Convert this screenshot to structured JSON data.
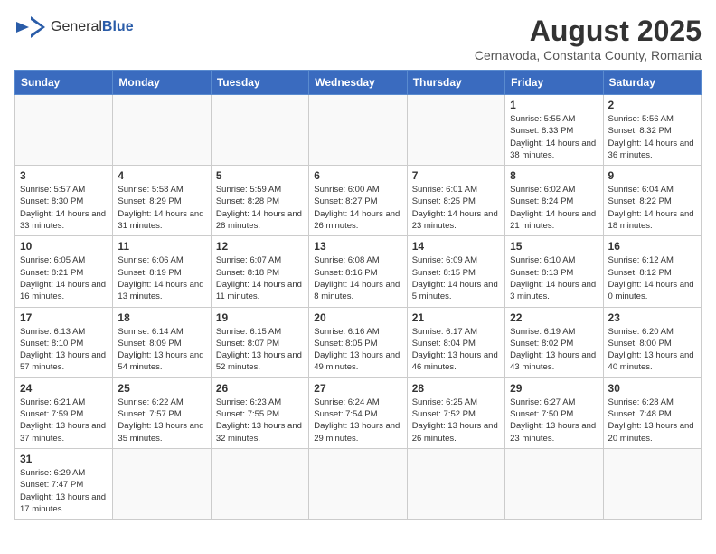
{
  "header": {
    "logo_general": "General",
    "logo_blue": "Blue",
    "month_year": "August 2025",
    "location": "Cernavoda, Constanta County, Romania"
  },
  "days_of_week": [
    "Sunday",
    "Monday",
    "Tuesday",
    "Wednesday",
    "Thursday",
    "Friday",
    "Saturday"
  ],
  "weeks": [
    [
      {
        "day": "",
        "info": ""
      },
      {
        "day": "",
        "info": ""
      },
      {
        "day": "",
        "info": ""
      },
      {
        "day": "",
        "info": ""
      },
      {
        "day": "",
        "info": ""
      },
      {
        "day": "1",
        "info": "Sunrise: 5:55 AM\nSunset: 8:33 PM\nDaylight: 14 hours and 38 minutes."
      },
      {
        "day": "2",
        "info": "Sunrise: 5:56 AM\nSunset: 8:32 PM\nDaylight: 14 hours and 36 minutes."
      }
    ],
    [
      {
        "day": "3",
        "info": "Sunrise: 5:57 AM\nSunset: 8:30 PM\nDaylight: 14 hours and 33 minutes."
      },
      {
        "day": "4",
        "info": "Sunrise: 5:58 AM\nSunset: 8:29 PM\nDaylight: 14 hours and 31 minutes."
      },
      {
        "day": "5",
        "info": "Sunrise: 5:59 AM\nSunset: 8:28 PM\nDaylight: 14 hours and 28 minutes."
      },
      {
        "day": "6",
        "info": "Sunrise: 6:00 AM\nSunset: 8:27 PM\nDaylight: 14 hours and 26 minutes."
      },
      {
        "day": "7",
        "info": "Sunrise: 6:01 AM\nSunset: 8:25 PM\nDaylight: 14 hours and 23 minutes."
      },
      {
        "day": "8",
        "info": "Sunrise: 6:02 AM\nSunset: 8:24 PM\nDaylight: 14 hours and 21 minutes."
      },
      {
        "day": "9",
        "info": "Sunrise: 6:04 AM\nSunset: 8:22 PM\nDaylight: 14 hours and 18 minutes."
      }
    ],
    [
      {
        "day": "10",
        "info": "Sunrise: 6:05 AM\nSunset: 8:21 PM\nDaylight: 14 hours and 16 minutes."
      },
      {
        "day": "11",
        "info": "Sunrise: 6:06 AM\nSunset: 8:19 PM\nDaylight: 14 hours and 13 minutes."
      },
      {
        "day": "12",
        "info": "Sunrise: 6:07 AM\nSunset: 8:18 PM\nDaylight: 14 hours and 11 minutes."
      },
      {
        "day": "13",
        "info": "Sunrise: 6:08 AM\nSunset: 8:16 PM\nDaylight: 14 hours and 8 minutes."
      },
      {
        "day": "14",
        "info": "Sunrise: 6:09 AM\nSunset: 8:15 PM\nDaylight: 14 hours and 5 minutes."
      },
      {
        "day": "15",
        "info": "Sunrise: 6:10 AM\nSunset: 8:13 PM\nDaylight: 14 hours and 3 minutes."
      },
      {
        "day": "16",
        "info": "Sunrise: 6:12 AM\nSunset: 8:12 PM\nDaylight: 14 hours and 0 minutes."
      }
    ],
    [
      {
        "day": "17",
        "info": "Sunrise: 6:13 AM\nSunset: 8:10 PM\nDaylight: 13 hours and 57 minutes."
      },
      {
        "day": "18",
        "info": "Sunrise: 6:14 AM\nSunset: 8:09 PM\nDaylight: 13 hours and 54 minutes."
      },
      {
        "day": "19",
        "info": "Sunrise: 6:15 AM\nSunset: 8:07 PM\nDaylight: 13 hours and 52 minutes."
      },
      {
        "day": "20",
        "info": "Sunrise: 6:16 AM\nSunset: 8:05 PM\nDaylight: 13 hours and 49 minutes."
      },
      {
        "day": "21",
        "info": "Sunrise: 6:17 AM\nSunset: 8:04 PM\nDaylight: 13 hours and 46 minutes."
      },
      {
        "day": "22",
        "info": "Sunrise: 6:19 AM\nSunset: 8:02 PM\nDaylight: 13 hours and 43 minutes."
      },
      {
        "day": "23",
        "info": "Sunrise: 6:20 AM\nSunset: 8:00 PM\nDaylight: 13 hours and 40 minutes."
      }
    ],
    [
      {
        "day": "24",
        "info": "Sunrise: 6:21 AM\nSunset: 7:59 PM\nDaylight: 13 hours and 37 minutes."
      },
      {
        "day": "25",
        "info": "Sunrise: 6:22 AM\nSunset: 7:57 PM\nDaylight: 13 hours and 35 minutes."
      },
      {
        "day": "26",
        "info": "Sunrise: 6:23 AM\nSunset: 7:55 PM\nDaylight: 13 hours and 32 minutes."
      },
      {
        "day": "27",
        "info": "Sunrise: 6:24 AM\nSunset: 7:54 PM\nDaylight: 13 hours and 29 minutes."
      },
      {
        "day": "28",
        "info": "Sunrise: 6:25 AM\nSunset: 7:52 PM\nDaylight: 13 hours and 26 minutes."
      },
      {
        "day": "29",
        "info": "Sunrise: 6:27 AM\nSunset: 7:50 PM\nDaylight: 13 hours and 23 minutes."
      },
      {
        "day": "30",
        "info": "Sunrise: 6:28 AM\nSunset: 7:48 PM\nDaylight: 13 hours and 20 minutes."
      }
    ],
    [
      {
        "day": "31",
        "info": "Sunrise: 6:29 AM\nSunset: 7:47 PM\nDaylight: 13 hours and 17 minutes."
      },
      {
        "day": "",
        "info": ""
      },
      {
        "day": "",
        "info": ""
      },
      {
        "day": "",
        "info": ""
      },
      {
        "day": "",
        "info": ""
      },
      {
        "day": "",
        "info": ""
      },
      {
        "day": "",
        "info": ""
      }
    ]
  ]
}
